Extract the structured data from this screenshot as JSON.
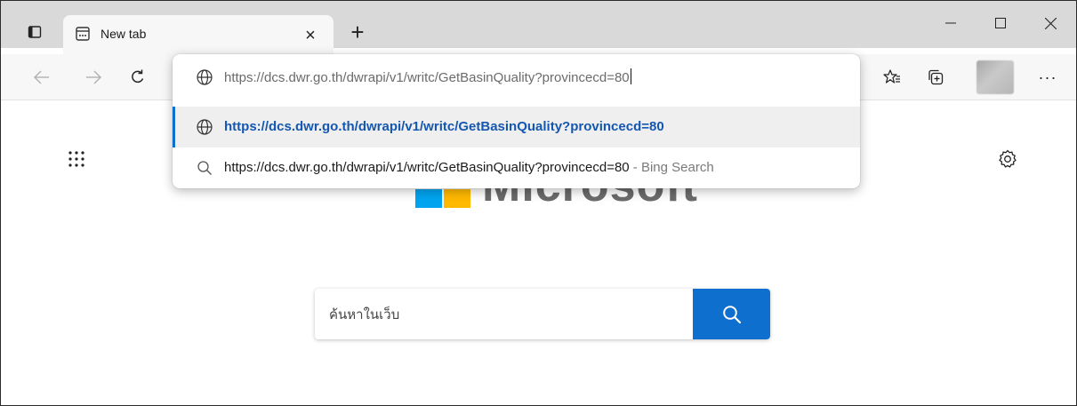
{
  "tab": {
    "title": "New tab",
    "close": "×",
    "new": "+"
  },
  "toolbar": {
    "more": "···"
  },
  "omnibox": {
    "url_host": "https://dcs.dwr.go.th",
    "url_rest": "/dwrapi/v1/writc/GetBasinQuality?provincecd=80",
    "suggestions": [
      {
        "icon": "globe-icon",
        "text": "https://dcs.dwr.go.th/dwrapi/v1/writc/GetBasinQuality?provincecd=80",
        "hint": ""
      },
      {
        "icon": "search-icon",
        "text": "https://dcs.dwr.go.th/dwrapi/v1/writc/GetBasinQuality?provincecd=80",
        "hint": " - Bing Search"
      }
    ]
  },
  "page": {
    "brand": "Microsoft",
    "search": {
      "placeholder": "ค้นหาในเว็บ"
    }
  },
  "colors": {
    "accent": "#0f6fcf",
    "tabstrip": "#d9d9d9",
    "toolbar": "#f7f7f7"
  }
}
